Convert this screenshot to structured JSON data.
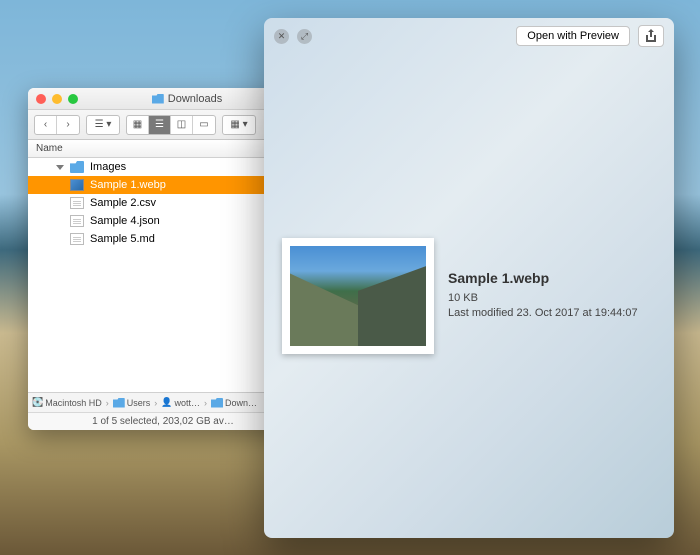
{
  "finder": {
    "title": "Downloads",
    "column_header": "Name",
    "files": [
      {
        "name": "Images",
        "type": "folder",
        "depth": 1
      },
      {
        "name": "Sample 1.webp",
        "type": "img",
        "depth": 2,
        "selected": true
      },
      {
        "name": "Sample 2.csv",
        "type": "doc",
        "depth": 2
      },
      {
        "name": "Sample 4.json",
        "type": "doc",
        "depth": 2
      },
      {
        "name": "Sample 5.md",
        "type": "doc",
        "depth": 2
      }
    ],
    "path": [
      "Macintosh HD",
      "Users",
      "wott…",
      "Down…"
    ],
    "status": "1 of 5 selected, 203,02 GB av…"
  },
  "quicklook": {
    "open_button": "Open with Preview",
    "filename": "Sample 1.webp",
    "size": "10 KB",
    "modified": "Last modified 23. Oct 2017 at 19:44:07"
  }
}
